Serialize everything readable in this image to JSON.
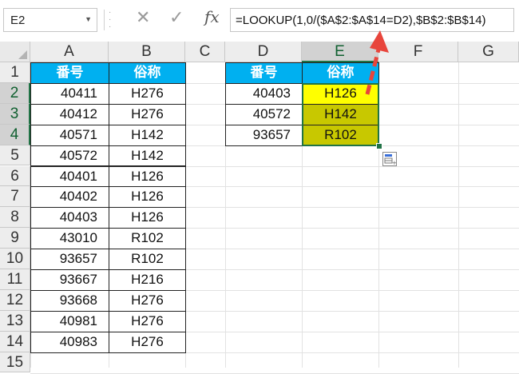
{
  "name_box": {
    "value": "E2"
  },
  "formula_bar": {
    "formula": "=LOOKUP(1,0/($A$2:$A$14=D2),$B$2:$B$14)",
    "fx_label": "fx",
    "cancel_glyph": "✕",
    "enter_glyph": "✓"
  },
  "columns": [
    "A",
    "B",
    "C",
    "D",
    "E",
    "F",
    "G"
  ],
  "rows": [
    "1",
    "2",
    "3",
    "4",
    "5",
    "6",
    "7",
    "8",
    "9",
    "10",
    "11",
    "12",
    "13",
    "14",
    "15"
  ],
  "source_table": {
    "headers": [
      "番号",
      "俗称"
    ],
    "rows": [
      [
        "40411",
        "H276"
      ],
      [
        "40412",
        "H276"
      ],
      [
        "40571",
        "H142"
      ],
      [
        "40572",
        "H142"
      ],
      [
        "40401",
        "H126"
      ],
      [
        "40402",
        "H126"
      ],
      [
        "40403",
        "H126"
      ],
      [
        "43010",
        "R102"
      ],
      [
        "93657",
        "R102"
      ],
      [
        "93667",
        "H216"
      ],
      [
        "93668",
        "H276"
      ],
      [
        "40981",
        "H276"
      ],
      [
        "40983",
        "H276"
      ]
    ]
  },
  "lookup_table": {
    "headers": [
      "番号",
      "俗称"
    ],
    "rows": [
      [
        "40403",
        "H126"
      ],
      [
        "40572",
        "H142"
      ],
      [
        "93657",
        "R102"
      ]
    ]
  },
  "selection": {
    "active_cell": "E2",
    "range": "E2:E4"
  },
  "colors": {
    "header_fill": "#00b0f0",
    "active_cell_fill": "#ffff00",
    "selected_range_fill": "#c8c800",
    "selection_border": "#217346",
    "arrow": "#e8453c"
  }
}
